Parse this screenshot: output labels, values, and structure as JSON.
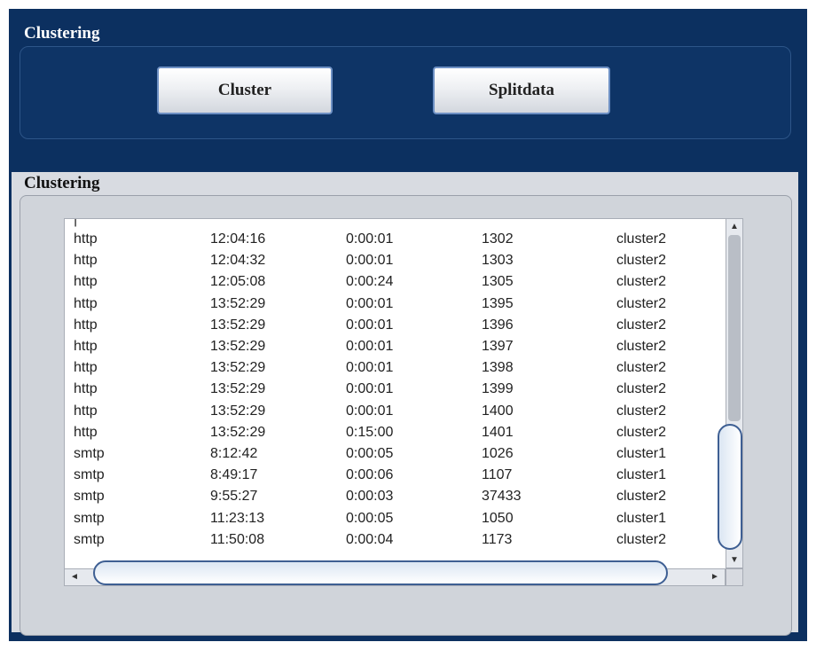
{
  "top_section": {
    "title": "Clustering"
  },
  "buttons": {
    "cluster": "Cluster",
    "splitdata": "Splitdata"
  },
  "bottom_section": {
    "title": "Clustering"
  },
  "rows": [
    [
      "http",
      "12:04:16",
      "0:00:01",
      "1302",
      "cluster2"
    ],
    [
      "http",
      "12:04:32",
      "0:00:01",
      "1303",
      "cluster2"
    ],
    [
      "http",
      "12:05:08",
      "0:00:24",
      "1305",
      "cluster2"
    ],
    [
      "http",
      "13:52:29",
      "0:00:01",
      "1395",
      "cluster2"
    ],
    [
      "http",
      "13:52:29",
      "0:00:01",
      "1396",
      "cluster2"
    ],
    [
      "http",
      "13:52:29",
      "0:00:01",
      "1397",
      "cluster2"
    ],
    [
      "http",
      "13:52:29",
      "0:00:01",
      "1398",
      "cluster2"
    ],
    [
      "http",
      "13:52:29",
      "0:00:01",
      "1399",
      "cluster2"
    ],
    [
      "http",
      "13:52:29",
      "0:00:01",
      "1400",
      "cluster2"
    ],
    [
      "http",
      "13:52:29",
      "0:15:00",
      "1401",
      "cluster2"
    ],
    [
      "smtp",
      "8:12:42",
      "0:00:05",
      "1026",
      "cluster1"
    ],
    [
      "smtp",
      "8:49:17",
      "0:00:06",
      "1107",
      "cluster1"
    ],
    [
      "smtp",
      "9:55:27",
      "0:00:03",
      "37433",
      "cluster2"
    ],
    [
      "smtp",
      "11:23:13",
      "0:00:05",
      "1050",
      "cluster1"
    ],
    [
      "smtp",
      "11:50:08",
      "0:00:04",
      "1173",
      "cluster2"
    ]
  ],
  "icons": {
    "scroll_up": "up-arrow",
    "scroll_down": "down-arrow",
    "scroll_left": "left-arrow",
    "scroll_right": "right-arrow"
  }
}
